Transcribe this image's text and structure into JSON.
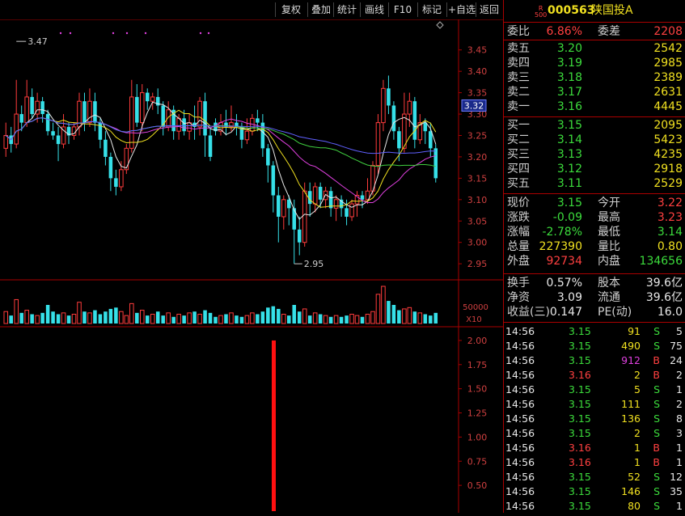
{
  "toolbar": {
    "buttons": [
      {
        "label": "复权",
        "name": "fuquan-button"
      },
      {
        "label": "叠加",
        "name": "overlay-button"
      },
      {
        "label": "统计",
        "name": "stats-button"
      },
      {
        "label": "画线",
        "name": "draw-line-button"
      },
      {
        "label": "F10",
        "name": "f10-button"
      },
      {
        "label": "标记",
        "name": "mark-button"
      },
      {
        "label": "+自选",
        "name": "add-watchlist-button"
      },
      {
        "label": "返回",
        "name": "back-button"
      }
    ]
  },
  "stock": {
    "rank_top": "R",
    "rank_bottom": "500",
    "code": "000563",
    "name": "陕国投A"
  },
  "order_book": {
    "ratio_label": "委比",
    "ratio_value": "6.86%",
    "diff_label": "委差",
    "diff_value": "2208",
    "asks": [
      {
        "label": "卖五",
        "price": "3.20",
        "volume": "2542"
      },
      {
        "label": "卖四",
        "price": "3.19",
        "volume": "2985"
      },
      {
        "label": "卖三",
        "price": "3.18",
        "volume": "2389"
      },
      {
        "label": "卖二",
        "price": "3.17",
        "volume": "2631"
      },
      {
        "label": "卖一",
        "price": "3.16",
        "volume": "4445"
      }
    ],
    "bids": [
      {
        "label": "买一",
        "price": "3.15",
        "volume": "2095"
      },
      {
        "label": "买二",
        "price": "3.14",
        "volume": "5423"
      },
      {
        "label": "买三",
        "price": "3.13",
        "volume": "4235"
      },
      {
        "label": "买四",
        "price": "3.12",
        "volume": "2918"
      },
      {
        "label": "买五",
        "price": "3.11",
        "volume": "2529"
      }
    ]
  },
  "quote": [
    {
      "l1": "现价",
      "v1": "3.15",
      "c1": "green",
      "l2": "今开",
      "v2": "3.22",
      "c2": "red"
    },
    {
      "l1": "涨跌",
      "v1": "-0.09",
      "c1": "green",
      "l2": "最高",
      "v2": "3.23",
      "c2": "red"
    },
    {
      "l1": "涨幅",
      "v1": "-2.78%",
      "c1": "green",
      "l2": "最低",
      "v2": "3.14",
      "c2": "green"
    },
    {
      "l1": "总量",
      "v1": "227390",
      "c1": "yellow",
      "l2": "量比",
      "v2": "0.80",
      "c2": "yellow"
    },
    {
      "l1": "外盘",
      "v1": "92734",
      "c1": "red",
      "l2": "内盘",
      "v2": "134656",
      "c2": "green"
    }
  ],
  "fundamentals": [
    {
      "l1": "换手",
      "v1": "0.57%",
      "l2": "股本",
      "v2": "39.6亿"
    },
    {
      "l1": "净资",
      "v1": "3.09",
      "l2": "流通",
      "v2": "39.6亿"
    },
    {
      "l1": "收益(三)",
      "v1": "0.147",
      "l2": "PE(动)",
      "v2": "16.0"
    }
  ],
  "ticks": [
    {
      "time": "14:56",
      "price": "3.15",
      "vol": "91",
      "bs": "S",
      "n": "5"
    },
    {
      "time": "14:56",
      "price": "3.15",
      "vol": "490",
      "bs": "S",
      "n": "75"
    },
    {
      "time": "14:56",
      "price": "3.15",
      "vol": "912",
      "bs": "B",
      "n": "24"
    },
    {
      "time": "14:56",
      "price": "3.16",
      "vol": "2",
      "bs": "B",
      "n": "2"
    },
    {
      "time": "14:56",
      "price": "3.15",
      "vol": "5",
      "bs": "S",
      "n": "1"
    },
    {
      "time": "14:56",
      "price": "3.15",
      "vol": "111",
      "bs": "S",
      "n": "2"
    },
    {
      "time": "14:56",
      "price": "3.15",
      "vol": "136",
      "bs": "S",
      "n": "8"
    },
    {
      "time": "14:56",
      "price": "3.15",
      "vol": "2",
      "bs": "S",
      "n": "3"
    },
    {
      "time": "14:56",
      "price": "3.16",
      "vol": "1",
      "bs": "B",
      "n": "1"
    },
    {
      "time": "14:56",
      "price": "3.16",
      "vol": "1",
      "bs": "B",
      "n": "1"
    },
    {
      "time": "14:56",
      "price": "3.15",
      "vol": "52",
      "bs": "S",
      "n": "12"
    },
    {
      "time": "14:56",
      "price": "3.15",
      "vol": "146",
      "bs": "S",
      "n": "35"
    },
    {
      "time": "14:56",
      "price": "3.15",
      "vol": "80",
      "bs": "S",
      "n": "1"
    }
  ],
  "chart_data": {
    "type": "candlestick",
    "price_axis": {
      "ticks": [
        "3.45",
        "3.40",
        "3.35",
        "3.30",
        "3.25",
        "3.20",
        "3.15",
        "3.10",
        "3.05",
        "3.00",
        "2.95"
      ],
      "ylim": [
        2.92,
        3.51
      ]
    },
    "current_price_label": "3.32",
    "high_marker": "3.47",
    "low_marker": "2.95",
    "volume_axis": {
      "label": "50000",
      "multiplier": "X10"
    },
    "indicator_axis": {
      "ticks": [
        "2.00",
        "1.75",
        "1.50",
        "1.25",
        "1.00",
        "0.75",
        "0.50"
      ],
      "ylim": [
        0.3,
        2.1
      ],
      "bar_value": 2.0
    },
    "candles": [
      [
        3.22,
        3.25,
        3.28,
        3.2
      ],
      [
        3.25,
        3.23,
        3.27,
        3.21
      ],
      [
        3.23,
        3.3,
        3.38,
        3.22
      ],
      [
        3.3,
        3.28,
        3.32,
        3.26
      ],
      [
        3.28,
        3.34,
        3.38,
        3.27
      ],
      [
        3.34,
        3.3,
        3.36,
        3.29
      ],
      [
        3.3,
        3.33,
        3.35,
        3.28
      ],
      [
        3.33,
        3.3,
        3.34,
        3.28
      ],
      [
        3.3,
        3.26,
        3.31,
        3.25
      ],
      [
        3.26,
        3.25,
        3.28,
        3.24
      ],
      [
        3.25,
        3.23,
        3.27,
        3.19
      ],
      [
        3.23,
        3.27,
        3.3,
        3.22
      ],
      [
        3.27,
        3.25,
        3.28,
        3.23
      ],
      [
        3.25,
        3.27,
        3.28,
        3.24
      ],
      [
        3.27,
        3.33,
        3.35,
        3.25
      ],
      [
        3.33,
        3.28,
        3.35,
        3.26
      ],
      [
        3.28,
        3.33,
        3.36,
        3.27
      ],
      [
        3.33,
        3.28,
        3.35,
        3.26
      ],
      [
        3.28,
        3.24,
        3.29,
        3.22
      ],
      [
        3.24,
        3.2,
        3.26,
        3.18
      ],
      [
        3.2,
        3.15,
        3.21,
        3.12
      ],
      [
        3.15,
        3.13,
        3.17,
        3.11
      ],
      [
        3.13,
        3.17,
        3.19,
        3.12
      ],
      [
        3.17,
        3.22,
        3.23,
        3.16
      ],
      [
        3.22,
        3.34,
        3.38,
        3.21
      ],
      [
        3.34,
        3.28,
        3.37,
        3.27
      ],
      [
        3.28,
        3.35,
        3.37,
        3.26
      ],
      [
        3.35,
        3.33,
        3.36,
        3.31
      ],
      [
        3.33,
        3.34,
        3.35,
        3.31
      ],
      [
        3.34,
        3.32,
        3.36,
        3.3
      ],
      [
        3.32,
        3.27,
        3.33,
        3.25
      ],
      [
        3.27,
        3.31,
        3.33,
        3.26
      ],
      [
        3.31,
        3.26,
        3.32,
        3.24
      ],
      [
        3.26,
        3.29,
        3.3,
        3.24
      ],
      [
        3.29,
        3.26,
        3.31,
        3.25
      ],
      [
        3.26,
        3.28,
        3.3,
        3.24
      ],
      [
        3.28,
        3.27,
        3.32,
        3.24
      ],
      [
        3.27,
        3.33,
        3.34,
        3.25
      ],
      [
        3.33,
        3.25,
        3.35,
        3.2
      ],
      [
        3.25,
        3.2,
        3.27,
        3.19
      ],
      [
        3.28,
        3.26,
        3.29,
        3.25
      ],
      [
        3.26,
        3.28,
        3.3,
        3.25
      ],
      [
        3.28,
        3.27,
        3.31,
        3.25
      ],
      [
        3.27,
        3.28,
        3.32,
        3.26
      ],
      [
        3.28,
        3.27,
        3.3,
        3.25
      ],
      [
        3.27,
        3.24,
        3.28,
        3.22
      ],
      [
        3.24,
        3.26,
        3.29,
        3.23
      ],
      [
        3.26,
        3.29,
        3.3,
        3.25
      ],
      [
        3.29,
        3.28,
        3.31,
        3.26
      ],
      [
        3.28,
        3.22,
        3.3,
        3.2
      ],
      [
        3.22,
        3.18,
        3.23,
        3.14
      ],
      [
        3.18,
        3.11,
        3.19,
        3.07
      ],
      [
        3.11,
        3.06,
        3.13,
        3.0
      ],
      [
        3.06,
        3.1,
        3.11,
        3.03
      ],
      [
        3.1,
        3.08,
        3.11,
        3.04
      ],
      [
        3.08,
        3.03,
        3.1,
        2.95
      ],
      [
        3.03,
        3.0,
        3.06,
        2.97
      ],
      [
        3.0,
        3.12,
        3.14,
        2.99
      ],
      [
        3.12,
        3.09,
        3.14,
        3.06
      ],
      [
        3.09,
        3.13,
        3.14,
        3.07
      ],
      [
        3.13,
        3.1,
        3.14,
        3.08
      ],
      [
        3.1,
        3.12,
        3.13,
        3.08
      ],
      [
        3.12,
        3.08,
        3.13,
        3.06
      ],
      [
        3.08,
        3.1,
        3.11,
        3.05
      ],
      [
        3.1,
        3.08,
        3.11,
        3.06
      ],
      [
        3.08,
        3.06,
        3.1,
        3.04
      ],
      [
        3.06,
        3.09,
        3.1,
        3.05
      ],
      [
        3.09,
        3.11,
        3.12,
        3.06
      ],
      [
        3.11,
        3.1,
        3.12,
        3.08
      ],
      [
        3.1,
        3.12,
        3.15,
        3.09
      ],
      [
        3.12,
        3.18,
        3.19,
        3.11
      ],
      [
        3.18,
        3.28,
        3.3,
        3.16
      ],
      [
        3.28,
        3.36,
        3.38,
        3.26
      ],
      [
        3.36,
        3.32,
        3.39,
        3.3
      ],
      [
        3.32,
        3.26,
        3.33,
        3.24
      ],
      [
        3.26,
        3.22,
        3.27,
        3.19
      ],
      [
        3.22,
        3.3,
        3.35,
        3.21
      ],
      [
        3.3,
        3.33,
        3.35,
        3.27
      ],
      [
        3.33,
        3.24,
        3.34,
        3.22
      ],
      [
        3.24,
        3.28,
        3.3,
        3.23
      ],
      [
        3.28,
        3.26,
        3.29,
        3.23
      ],
      [
        3.26,
        3.22,
        3.28,
        3.2
      ],
      [
        3.22,
        3.15,
        3.23,
        3.14
      ]
    ],
    "volumes": [
      9,
      6,
      18,
      8,
      10,
      7,
      6,
      8,
      14,
      9,
      7,
      8,
      6,
      7,
      16,
      9,
      8,
      10,
      7,
      9,
      11,
      12,
      9,
      6,
      15,
      8,
      10,
      6,
      7,
      9,
      6,
      8,
      5,
      7,
      6,
      8,
      9,
      7,
      10,
      8,
      5,
      6,
      7,
      8,
      6,
      5,
      6,
      8,
      7,
      9,
      12,
      13,
      11,
      7,
      6,
      14,
      9,
      11,
      6,
      8,
      7,
      6,
      5,
      6,
      5,
      6,
      7,
      6,
      5,
      7,
      9,
      22,
      28,
      17,
      14,
      10,
      11,
      12,
      9,
      8,
      7,
      6,
      8
    ]
  }
}
